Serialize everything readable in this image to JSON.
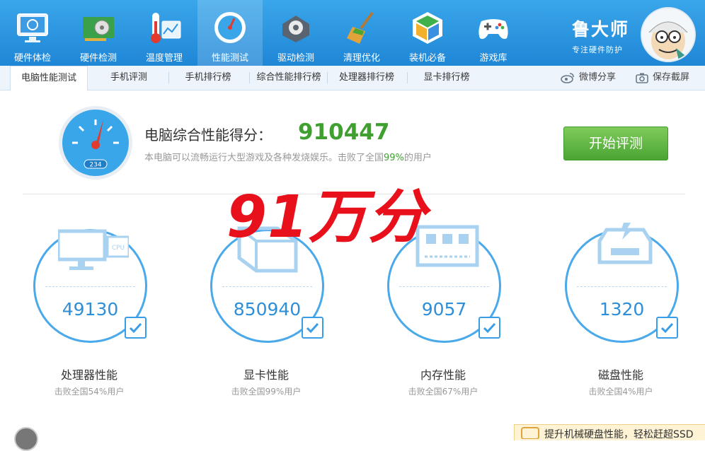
{
  "nav": {
    "items": [
      {
        "label": "硬件体检"
      },
      {
        "label": "硬件检测"
      },
      {
        "label": "温度管理"
      },
      {
        "label": "性能测试"
      },
      {
        "label": "驱动检测"
      },
      {
        "label": "清理优化"
      },
      {
        "label": "装机必备"
      },
      {
        "label": "游戏库"
      }
    ],
    "active_index": 3
  },
  "brand": {
    "name": "鲁大师",
    "slogan": "专注硬件防护"
  },
  "tabs": [
    {
      "label": "电脑性能测试"
    },
    {
      "label": "手机评测"
    },
    {
      "label": "手机排行榜"
    },
    {
      "label": "综合性能排行榜"
    },
    {
      "label": "处理器排行榜"
    },
    {
      "label": "显卡排行榜"
    }
  ],
  "tools": {
    "share": "微博分享",
    "screenshot": "保存截屏"
  },
  "score": {
    "title": "电脑综合性能得分：",
    "value": "910447",
    "desc_prefix": "本电脑可以流畅运行大型游戏及各种发烧娱乐。击败了全国",
    "desc_pct": "99%",
    "desc_suffix": "的用户",
    "gauge_readout": "234"
  },
  "start_button": "开始评测",
  "overlay_caption": "91万分",
  "metrics": [
    {
      "value": "49130",
      "title": "处理器性能",
      "sub": "击败全国54%用户",
      "chip": "CPU"
    },
    {
      "value": "850940",
      "title": "显卡性能",
      "sub": "击败全国99%用户"
    },
    {
      "value": "9057",
      "title": "内存性能",
      "sub": "击败全国67%用户"
    },
    {
      "value": "1320",
      "title": "磁盘性能",
      "sub": "击败全国4%用户"
    }
  ],
  "banner": "提升机械硬盘性能，轻松赶超SSD",
  "colors": {
    "primary": "#2f95e0",
    "score_green": "#3fa030",
    "overlay_red": "#e8101a"
  }
}
